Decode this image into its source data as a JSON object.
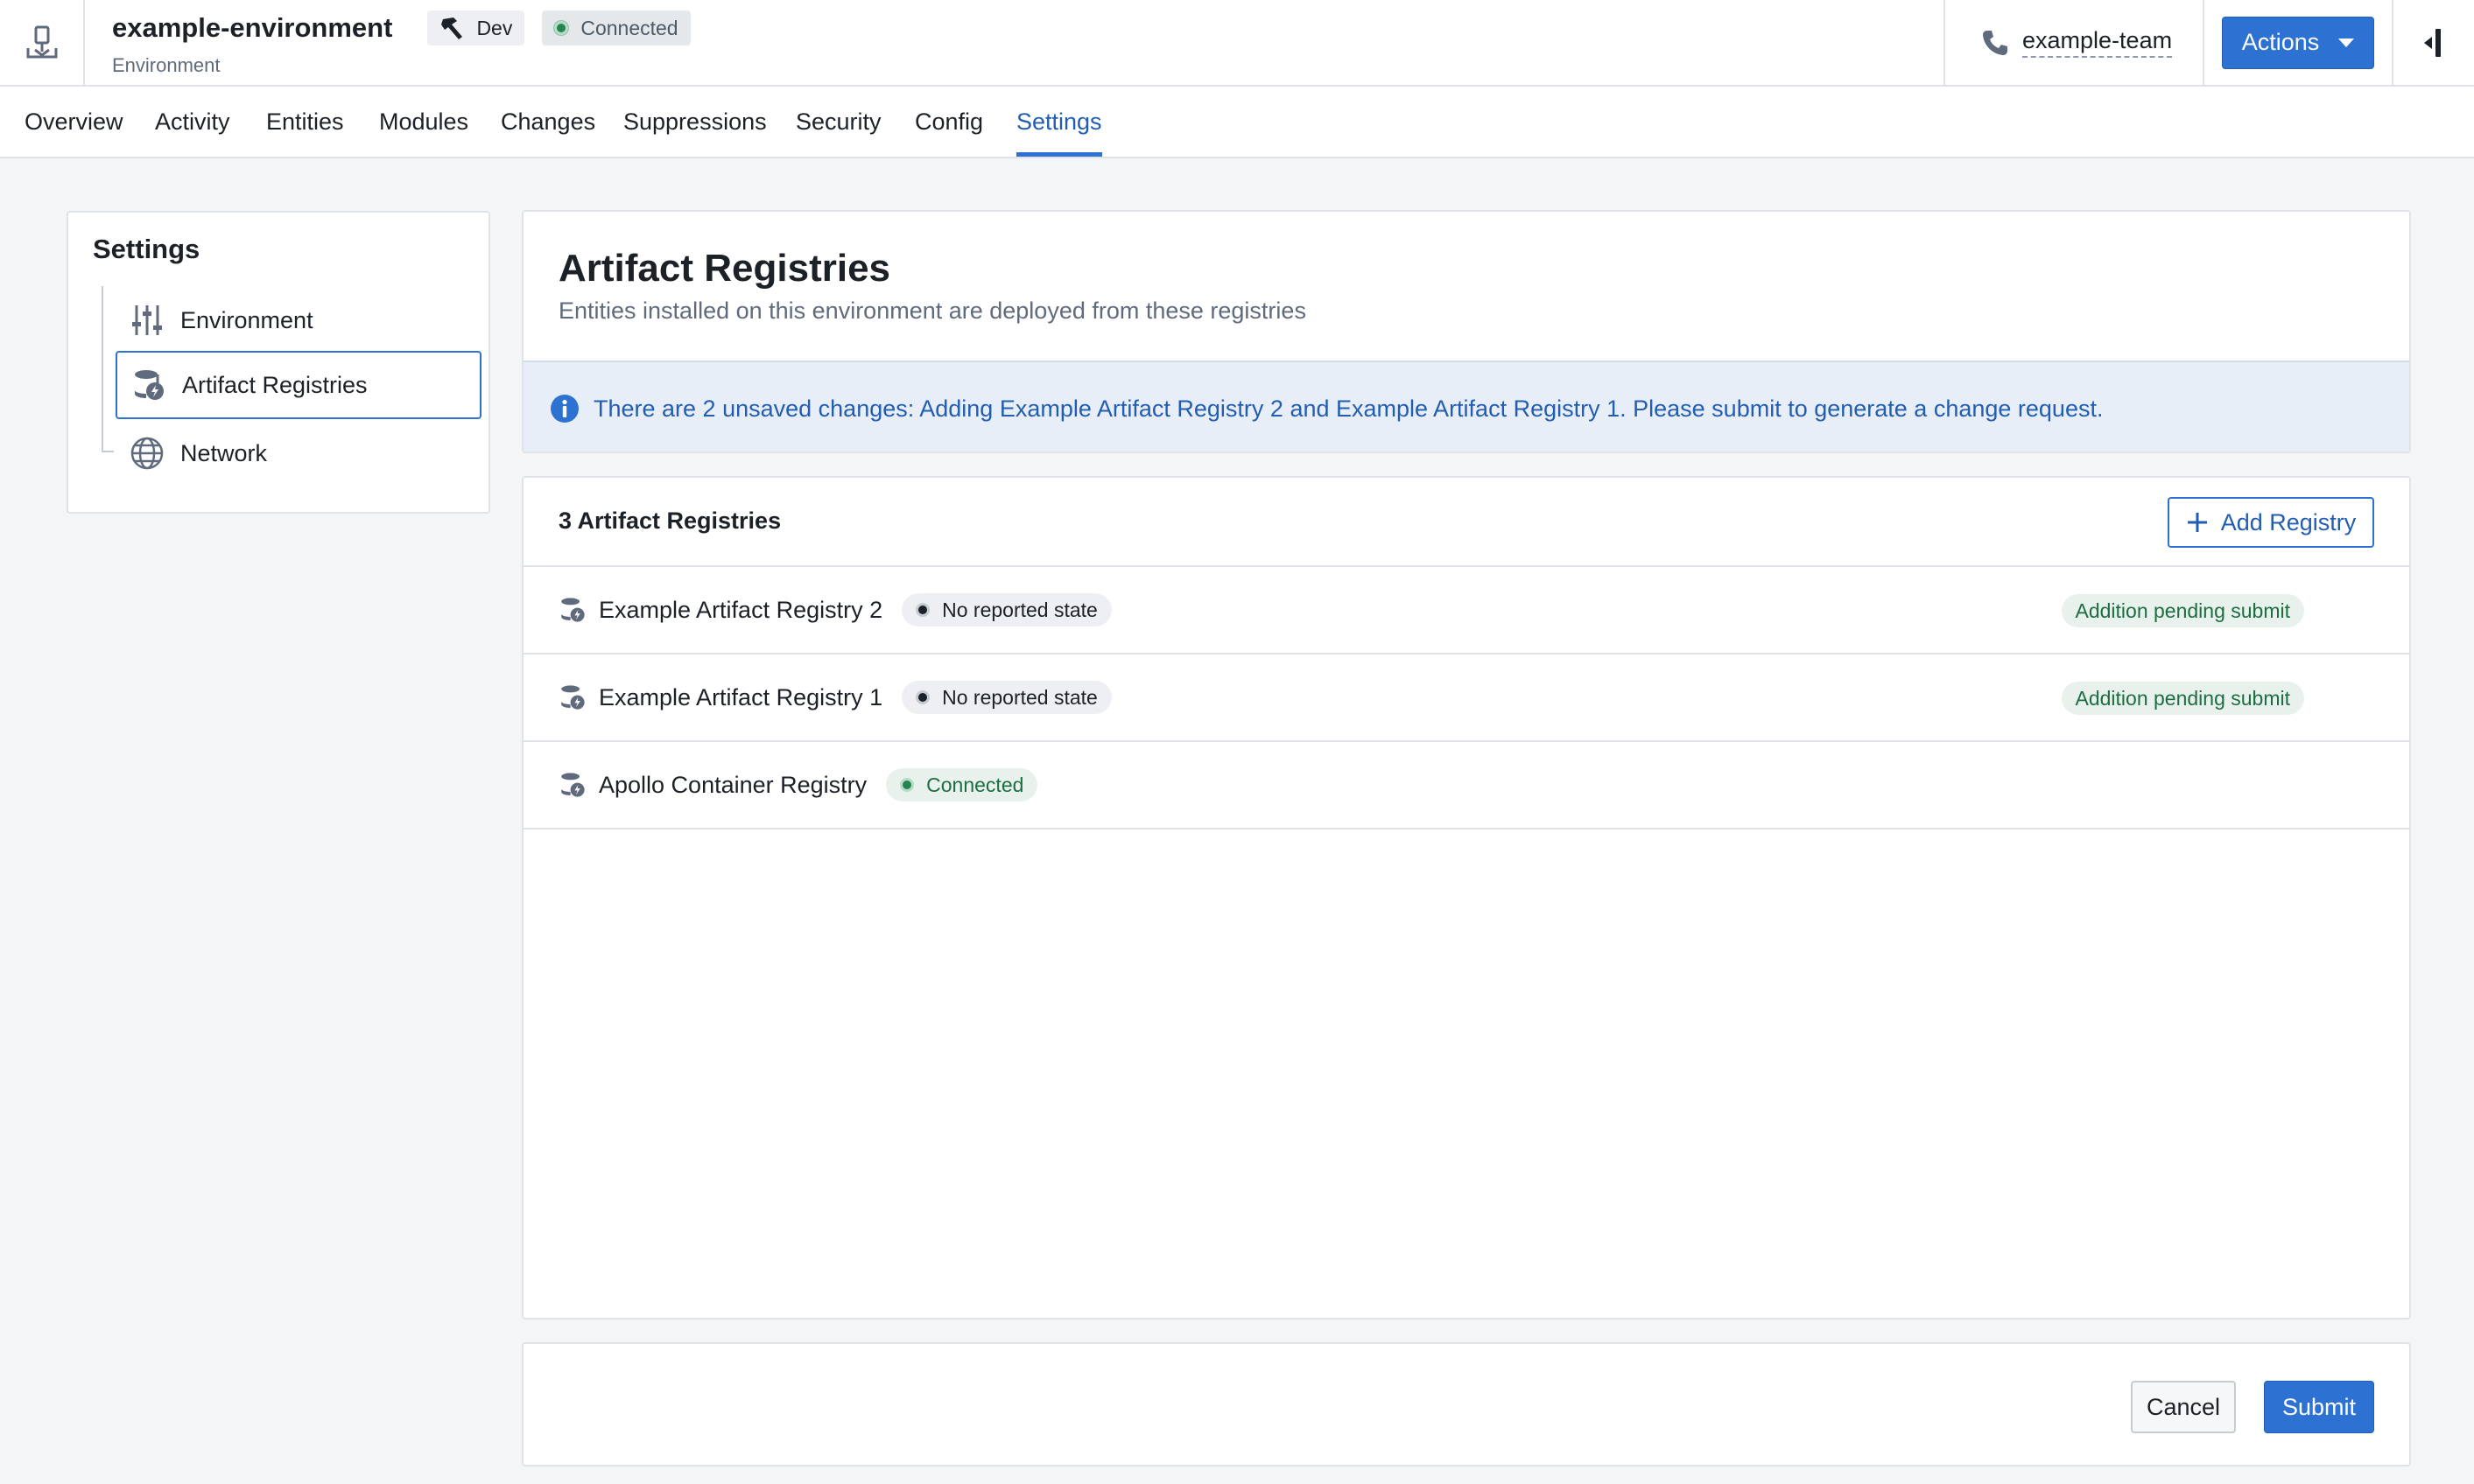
{
  "header": {
    "environment_name": "example-environment",
    "environment_type": "Environment",
    "dev_tag": "Dev",
    "status_tag": "Connected",
    "team": "example-team",
    "actions_label": "Actions"
  },
  "tabs": [
    {
      "label": "Overview"
    },
    {
      "label": "Activity"
    },
    {
      "label": "Entities"
    },
    {
      "label": "Modules"
    },
    {
      "label": "Changes"
    },
    {
      "label": "Suppressions"
    },
    {
      "label": "Security"
    },
    {
      "label": "Config"
    },
    {
      "label": "Settings",
      "active": true
    }
  ],
  "settings_nav": {
    "title": "Settings",
    "items": [
      {
        "label": "Environment",
        "icon": "sliders-icon"
      },
      {
        "label": "Artifact Registries",
        "icon": "database-icon",
        "selected": true
      },
      {
        "label": "Network",
        "icon": "globe-icon"
      }
    ]
  },
  "main": {
    "title": "Artifact Registries",
    "subtitle": "Entities installed on this environment are deployed from these registries",
    "callout": "There are 2 unsaved changes: Adding Example Artifact Registry 2 and Example Artifact Registry 1. Please submit to generate a change request."
  },
  "registries": {
    "count_label": "3 Artifact Registries",
    "add_label": "Add Registry",
    "rows": [
      {
        "name": "Example Artifact Registry 2",
        "state": "No reported state",
        "pending": "Addition pending submit"
      },
      {
        "name": "Example Artifact Registry 1",
        "state": "No reported state",
        "pending": "Addition pending submit"
      },
      {
        "name": "Apollo Container Registry",
        "state": "Connected",
        "pending": ""
      }
    ]
  },
  "footer": {
    "cancel_label": "Cancel",
    "submit_label": "Submit"
  },
  "colors": {
    "accent": "#2d72d2",
    "accent_text": "#215db0",
    "success": "#238551",
    "callout_bg": "#e8eef8"
  }
}
